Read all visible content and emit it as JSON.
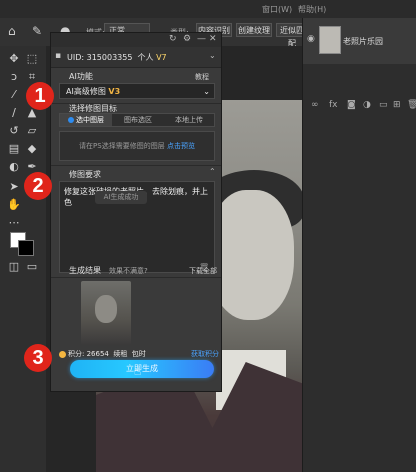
{
  "app": {
    "menu": [
      "窗口(W)",
      "帮助(H)"
    ],
    "options_bar": {
      "mode_label": "模式:",
      "mode_value": "正常",
      "buttons": [
        "类型:",
        "内容识别",
        "创建纹理",
        "近似匹配"
      ]
    },
    "layers": {
      "layer_name": "老照片乐园"
    }
  },
  "plugin": {
    "uid_label": "UID:",
    "uid": "315003355",
    "account_type": "个人",
    "account_level": "V7",
    "ai_section_label": "AI功能",
    "tutorial_label": "教程",
    "ai_select_value": "AI高级修图",
    "ai_select_version": "V3",
    "target_section_label": "选择修图目标",
    "targets": [
      "选中图层",
      "图布选区",
      "本地上传"
    ],
    "hint_text": "请在PS选择需要修图的图层",
    "hint_link": "点击预览",
    "requirement_label": "修图要求",
    "requirement_text": "修复这张破损的老照片，去除划痕，并上色",
    "toast_text": "AI生成成功",
    "result_label": "生成结果",
    "result_tag": "效果不满意?",
    "download_label": "下载全部",
    "points_label": "积分:",
    "points_value": "26654",
    "points_recharge": "续租",
    "points_extra": "包时",
    "get_points_label": "获取积分",
    "generate_button": "立即生成"
  },
  "badges": [
    "1",
    "2",
    "3"
  ],
  "colors": {
    "accent": "#27c8ff",
    "badge": "#e0251b",
    "link": "#4aa3ff",
    "points_coin": "#f5b640",
    "version": "#f2b544"
  }
}
